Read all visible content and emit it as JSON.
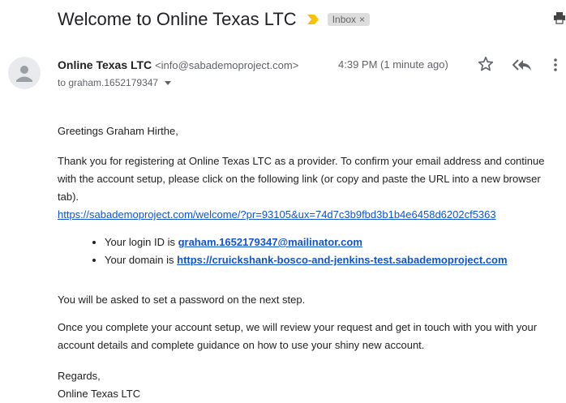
{
  "subject": "Welcome to Online Texas LTC",
  "label": {
    "text": "Inbox",
    "close": "×"
  },
  "sender": {
    "name": "Online Texas LTC",
    "email": "<info@sabademoproject.com>",
    "time": "4:39 PM (1 minute ago)",
    "to": "to graham.1652179347"
  },
  "body": {
    "greeting": "Greetings Graham Hirthe,",
    "para1": "Thank you for registering at Online Texas LTC as a provider. To confirm your email address and continue with the account setup, please click on the following link (or copy and paste the URL into a new browser tab).",
    "confirm_link": "https://sabademoproject.com/welcome/?pr=93105&ux=74d7c3b9fbd3b1b4e6458d6202cf5363",
    "login_prefix": "Your login ID is ",
    "login_id": "graham.1652179347@mailinator.com",
    "domain_prefix": "Your domain is ",
    "domain": "https://cruickshank-bosco-and-jenkins-test.sabademoproject.com",
    "para2": "You will be asked to set a password on the next step.",
    "para3": "Once you complete your account setup, we will review your request and get in touch with you with your account details and complete guidance on how to use your shiny new account.",
    "regards": "Regards,",
    "signature": "Online Texas LTC"
  },
  "icons": {
    "importance": "importance-marker-icon",
    "print": "print-icon",
    "avatar": "default-avatar-icon",
    "star": "star-icon",
    "reply_all": "reply-all-icon",
    "more": "more-vert-icon",
    "label_color": "#f4c20d"
  }
}
